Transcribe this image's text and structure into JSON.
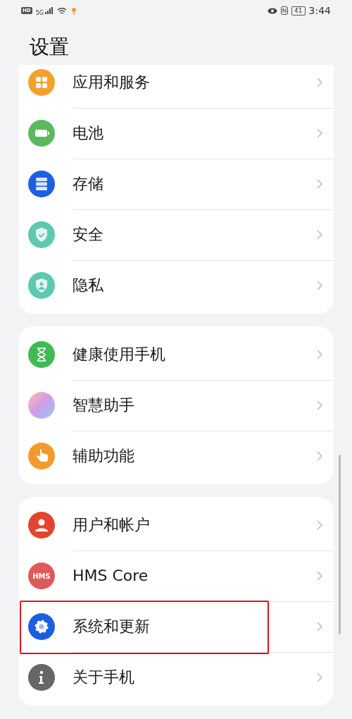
{
  "status_bar": {
    "hd": "HD",
    "network": "5G",
    "battery": "41",
    "time": "3:44"
  },
  "title": "设置",
  "groups": [
    {
      "items": [
        {
          "label": "应用和服务",
          "color": "#f4a12c",
          "highlighted": false
        },
        {
          "label": "电池",
          "color": "#5cb85c",
          "highlighted": false
        },
        {
          "label": "存储",
          "color": "#1d5fe0",
          "highlighted": false
        },
        {
          "label": "安全",
          "color": "#5ec9b2",
          "highlighted": false
        },
        {
          "label": "隐私",
          "color": "#5ec9b2",
          "highlighted": false
        }
      ]
    },
    {
      "items": [
        {
          "label": "健康使用手机",
          "color": "#3fba55",
          "highlighted": false
        },
        {
          "label": "智慧助手",
          "color": "#c9a0e8",
          "highlighted": false
        },
        {
          "label": "辅助功能",
          "color": "#f39a2a",
          "highlighted": false
        }
      ]
    },
    {
      "items": [
        {
          "label": "用户和帐户",
          "color": "#e2452e",
          "highlighted": false
        },
        {
          "label": "HMS Core",
          "icon_text": "HMS",
          "color": "#e05a5a",
          "highlighted": false
        },
        {
          "label": "系统和更新",
          "color": "#1b5fe0",
          "highlighted": true
        },
        {
          "label": "关于手机",
          "color": "#666666",
          "highlighted": false
        }
      ]
    }
  ]
}
